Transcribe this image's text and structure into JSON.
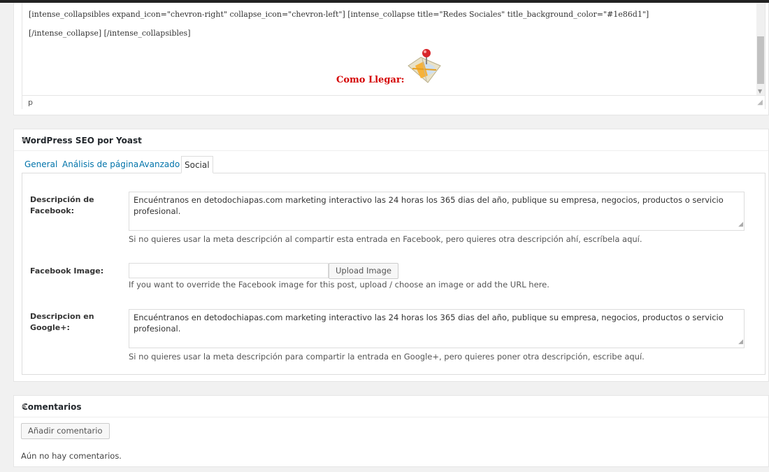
{
  "editor": {
    "line1": "[intense_collapsibles expand_icon=\"chevron-right\" collapse_icon=\"chevron-left\"] [intense_collapse title=\"Redes Sociales\" title_background_color=\"#1e86d1\"]",
    "line2": "[/intense_collapse] [/intense_collapsibles]",
    "como_llegar": "Como Llegar:",
    "status_path": "p"
  },
  "seo_box": {
    "title": "WordPress SEO por Yoast",
    "tabs": [
      {
        "label": "General"
      },
      {
        "label": "Análisis de página"
      },
      {
        "label": "Avanzado"
      },
      {
        "label": "Social"
      }
    ],
    "facebook_description": {
      "label": "Descripción de Facebook:",
      "value": "Encuéntranos en detodochiapas.com marketing interactivo las 24 horas los 365 dias del año, publique su empresa, negocios, productos o servicio profesional.",
      "help": "Si no quieres usar la meta descripción al compartir esta entrada en Facebook, pero quieres otra descripción ahí, escríbela aquí."
    },
    "facebook_image": {
      "label": "Facebook Image:",
      "value": "",
      "button": "Upload Image",
      "help": "If you want to override the Facebook image for this post, upload / choose an image or add the URL here."
    },
    "google_description": {
      "label": "Descripcion en Google+:",
      "value": "Encuéntranos en detodochiapas.com marketing interactivo las 24 horas los 365 dias del año, publique su empresa, negocios, productos o servicio profesional.",
      "help": "Si no quieres usar la meta descripción para compartir la entrada en Google+, pero quieres poner otra descripción, escribe aquí."
    }
  },
  "comments_box": {
    "title": "Comentarios",
    "add_button": "Añadir comentario",
    "empty_text": "Aún no hay comentarios."
  },
  "colors": {
    "link": "#0073aa",
    "como_llegar": "#d40000"
  },
  "icons": {
    "map": "map-pin-icon",
    "toggle": "triangle-up-icon"
  }
}
